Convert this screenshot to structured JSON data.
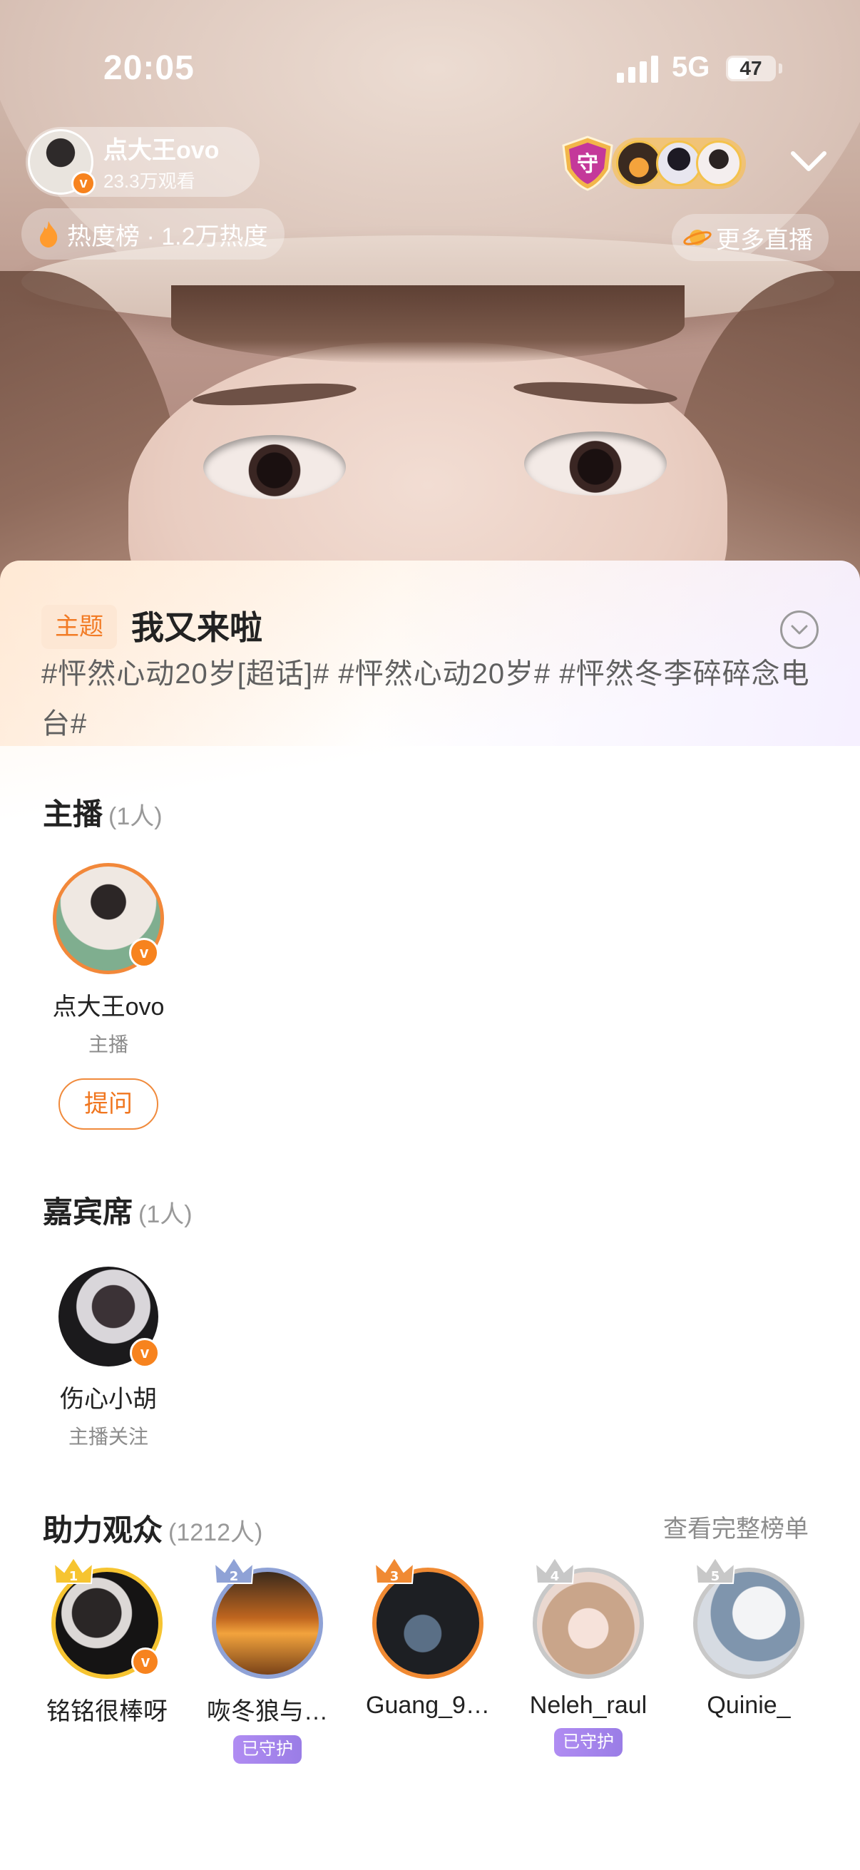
{
  "status_bar": {
    "time": "20:05",
    "network": "5G",
    "battery": "47",
    "battery_level": 0.47
  },
  "live_header": {
    "host_name": "点大王ovo",
    "viewers": "23.3万观看",
    "guard_label": "守",
    "heat_rank": "热度榜 · 1.2万热度",
    "more_live": "更多直播"
  },
  "topic": {
    "tag": "主题",
    "title": "我又来啦",
    "hashtags": "#怦然心动20岁[超话]# #怦然心动20岁# #怦然冬李碎碎念电台#"
  },
  "hosts_section": {
    "title": "主播",
    "count": "(1人)",
    "person": {
      "name": "点大王ovo",
      "role": "主播"
    },
    "ask_button": "提问"
  },
  "guests_section": {
    "title": "嘉宾席",
    "count": "(1人)",
    "person": {
      "name": "伤心小胡",
      "role": "主播关注"
    }
  },
  "supporters_section": {
    "title": "助力观众",
    "count": "(1212人)",
    "view_full_list": "查看完整榜单",
    "fans": [
      {
        "rank": "1",
        "name": "铭铭很棒呀",
        "badge": "",
        "ring_color": "#f6c431"
      },
      {
        "rank": "2",
        "name": "咴冬狼与…",
        "badge": "已守护",
        "ring_color": "#8fa2d6"
      },
      {
        "rank": "3",
        "name": "Guang_9…",
        "badge": "",
        "ring_color": "#f08a33"
      },
      {
        "rank": "4",
        "name": "Neleh_raul",
        "badge": "已守护",
        "ring_color": "#c8c8c8"
      },
      {
        "rank": "5",
        "name": "Quinie_",
        "badge": "",
        "ring_color": "#c8c8c8"
      }
    ]
  },
  "colors": {
    "accent": "#f27b25",
    "badge": "#f7831e",
    "guard_purple": "#a283ea"
  }
}
